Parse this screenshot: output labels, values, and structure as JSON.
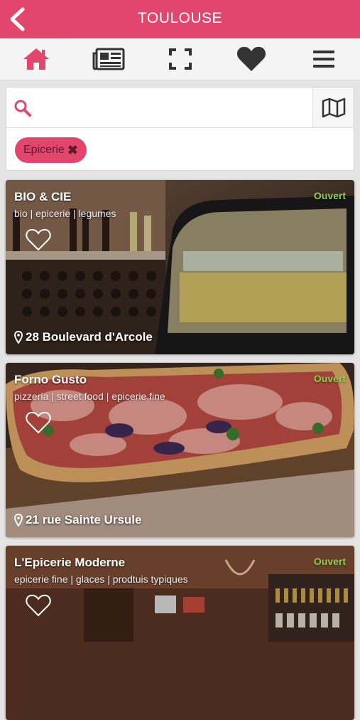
{
  "header": {
    "title": "TOULOUSE",
    "back_icon": "chevron-left-icon",
    "background": "#e2466c"
  },
  "nav": {
    "items": [
      {
        "icon": "home-icon"
      },
      {
        "icon": "newspaper-icon"
      },
      {
        "icon": "scan-icon"
      },
      {
        "icon": "heart-icon"
      },
      {
        "icon": "menu-icon"
      }
    ],
    "active_color": "#e2466c"
  },
  "search": {
    "value": "",
    "placeholder": "",
    "icon": "search-icon",
    "map_icon": "map-icon"
  },
  "filters": [
    {
      "label": "Epicerie",
      "remove_icon": "close-icon"
    }
  ],
  "places": [
    {
      "name": "BIO & CIE",
      "tags": "bio | epicerie | legumes",
      "status": "Ouvert",
      "address": "28 Boulevard d'Arcole"
    },
    {
      "name": "Forno Gusto",
      "tags": "pizzeria | street food | epicerie fine",
      "status": "Ouvert",
      "address": "21 rue Sainte Ursule"
    },
    {
      "name": "L'Epicerie Moderne",
      "tags": "epicerie fine | glaces | prodtuis typiques",
      "status": "Ouvert",
      "address": ""
    }
  ]
}
